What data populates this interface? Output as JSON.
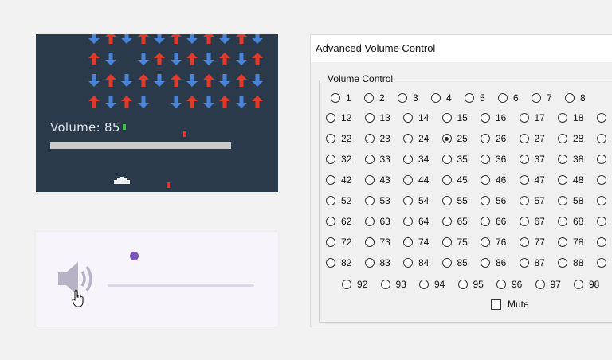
{
  "game": {
    "volume_label": "Volume: 85",
    "volume_value": 85,
    "arrow_rows": [
      [
        "down",
        "up",
        "down",
        "up",
        "down",
        "up",
        "down",
        "up",
        "down",
        "up",
        "down"
      ],
      [
        "up",
        "down",
        null,
        "down",
        "up",
        "down",
        "up",
        "down",
        "up",
        "down",
        "up"
      ],
      [
        "down",
        "up",
        "down",
        "up",
        "down",
        "up",
        "down",
        "up",
        "down",
        "up",
        "down"
      ],
      [
        "up",
        "down",
        "up",
        "down",
        null,
        "down",
        "up",
        "down",
        "up",
        "down",
        "up"
      ]
    ],
    "colors": {
      "up": "#e03a2b",
      "down": "#4a84d8",
      "background": "#2b3a4a"
    }
  },
  "slider_widget": {
    "speaker_icon": "speaker-icon",
    "cursor_icon": "hand-pointer-icon"
  },
  "dialog": {
    "title": "Advanced Volume Control",
    "group_label": "Volume Control",
    "selected": 25,
    "mute_label": "Mute",
    "mute_checked": false,
    "rows": [
      [
        "1",
        "2",
        "3",
        "4",
        "5",
        "6",
        "7",
        "8"
      ],
      [
        "12",
        "13",
        "14",
        "15",
        "16",
        "17",
        "18",
        ""
      ],
      [
        "22",
        "23",
        "24",
        "25",
        "26",
        "27",
        "28",
        ""
      ],
      [
        "32",
        "33",
        "34",
        "35",
        "36",
        "37",
        "38",
        ""
      ],
      [
        "42",
        "43",
        "44",
        "45",
        "46",
        "47",
        "48",
        ""
      ],
      [
        "52",
        "53",
        "54",
        "55",
        "56",
        "57",
        "58",
        ""
      ],
      [
        "62",
        "63",
        "64",
        "65",
        "66",
        "67",
        "68",
        ""
      ],
      [
        "72",
        "73",
        "74",
        "75",
        "76",
        "77",
        "78",
        ""
      ],
      [
        "82",
        "83",
        "84",
        "85",
        "86",
        "87",
        "88",
        ""
      ],
      [
        "92",
        "93",
        "94",
        "95",
        "96",
        "97",
        "98"
      ]
    ]
  }
}
